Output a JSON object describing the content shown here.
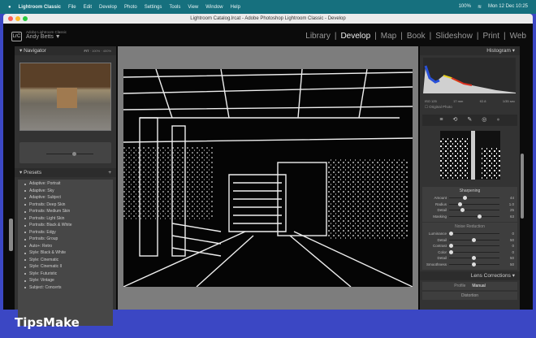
{
  "menubar": {
    "app": "Lightroom Classic",
    "items": [
      "File",
      "Edit",
      "Develop",
      "Photo",
      "Settings",
      "Tools",
      "View",
      "Window",
      "Help"
    ],
    "battery": "100%",
    "datetime": "Mon 12 Dec 10:25"
  },
  "window": {
    "title": "Lightroom Catalog.lrcat - Adobe Photoshop Lightroom Classic - Develop"
  },
  "identity": {
    "logo": "LrC",
    "product": "Adobe Lightroom Classic",
    "user": "Andy Betts ▼"
  },
  "modules": [
    "Library",
    "Develop",
    "Map",
    "Book",
    "Slideshow",
    "Print",
    "Web"
  ],
  "modules_active": "Develop",
  "navigator": {
    "title": "Navigator",
    "zoom_options": [
      "FIT",
      "100%",
      "400%"
    ]
  },
  "presets": {
    "title": "Presets",
    "items": [
      "Adaptive: Portrait",
      "Adaptive: Sky",
      "Adaptive: Subject",
      "Portraits: Deep Skin",
      "Portraits: Medium Skin",
      "Portraits: Light Skin",
      "Portraits: Black & White",
      "Portraits: Edgy",
      "Portraits: Group",
      "Auto+: Retro",
      "Style: Black & White",
      "Style: Cinematic",
      "Style: Cinematic II",
      "Style: Futuristic",
      "Style: Vintage",
      "Subject: Concerts"
    ]
  },
  "histogram": {
    "title": "Histogram",
    "iso": "ISO 125",
    "focal": "17 mm",
    "aperture": "f/2.8",
    "shutter": "1/35 sec",
    "original_photo": "Original Photo"
  },
  "sharpening": {
    "title": "Sharpening",
    "sliders": [
      {
        "label": "Amount",
        "value": "44",
        "pos": 0.3
      },
      {
        "label": "Radius",
        "value": "1.0",
        "pos": 0.2
      },
      {
        "label": "Detail",
        "value": "25",
        "pos": 0.25
      },
      {
        "label": "Masking",
        "value": "63",
        "pos": 0.63
      }
    ]
  },
  "noise": {
    "title": "Noise Reduction",
    "sliders": [
      {
        "label": "Luminance",
        "value": "0",
        "pos": 0
      },
      {
        "label": "Detail",
        "value": "50",
        "pos": 0.5
      },
      {
        "label": "Contrast",
        "value": "0",
        "pos": 0
      },
      {
        "label": "Color",
        "value": "0",
        "pos": 0
      },
      {
        "label": "Detail",
        "value": "50",
        "pos": 0.5
      },
      {
        "label": "Smoothness",
        "value": "50",
        "pos": 0.5
      }
    ]
  },
  "lens": {
    "title": "Lens Corrections",
    "tabs": [
      "Profile",
      "Manual"
    ],
    "section": "Distortion"
  },
  "watermark": "TipsMake"
}
